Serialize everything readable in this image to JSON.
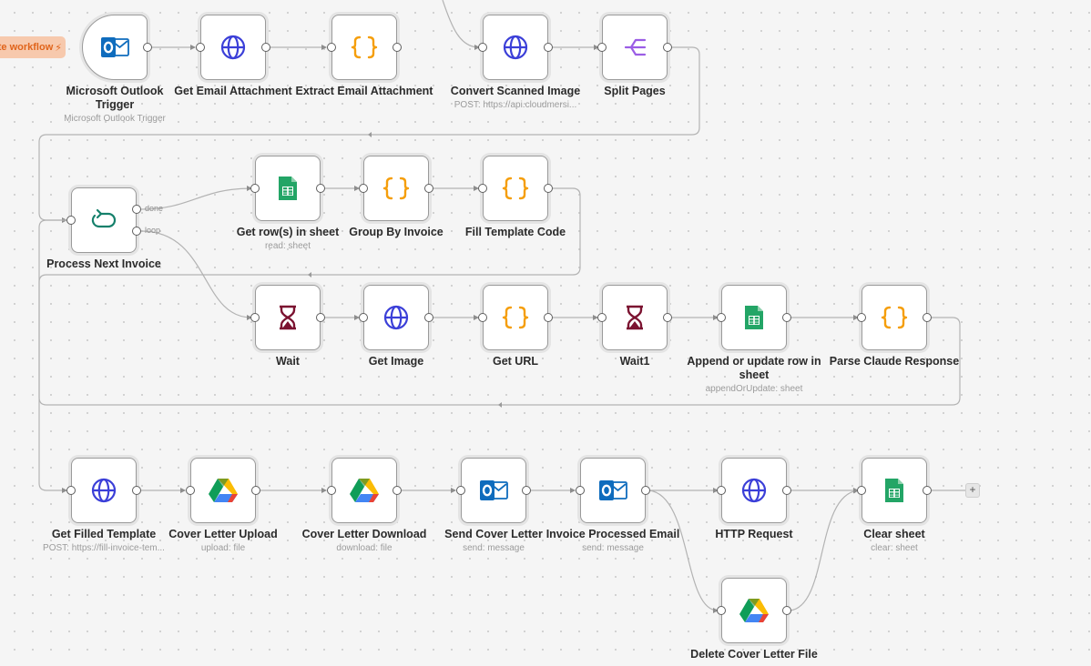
{
  "banner": {
    "text": "te workflow"
  },
  "nodes": [
    {
      "id": "outlook-trigger",
      "label": "Microsoft Outlook Trigger",
      "sub": "Microsoft Outlook Trigger",
      "icon": "outlook-icon",
      "trigger": true
    },
    {
      "id": "get-email-attachment",
      "label": "Get Email Attachment",
      "sub": "",
      "icon": "globe-icon"
    },
    {
      "id": "extract-email-attachment",
      "label": "Extract Email Attachment",
      "sub": "",
      "icon": "code-braces-icon"
    },
    {
      "id": "convert-scanned-image",
      "label": "Convert Scanned Image",
      "sub": "POST: https://api.cloudmersi...",
      "icon": "globe-icon"
    },
    {
      "id": "split-pages",
      "label": "Split Pages",
      "sub": "",
      "icon": "split-icon"
    },
    {
      "id": "process-next-invoice",
      "label": "Process Next Invoice",
      "sub": "",
      "icon": "loop-icon"
    },
    {
      "id": "get-rows-in-sheet",
      "label": "Get row(s) in sheet",
      "sub": "read: sheet",
      "icon": "sheets-icon"
    },
    {
      "id": "group-by-invoice",
      "label": "Group By Invoice",
      "sub": "",
      "icon": "code-braces-icon"
    },
    {
      "id": "fill-template-code",
      "label": "Fill Template Code",
      "sub": "",
      "icon": "code-braces-icon"
    },
    {
      "id": "wait",
      "label": "Wait",
      "sub": "",
      "icon": "hourglass-icon"
    },
    {
      "id": "get-image",
      "label": "Get Image",
      "sub": "",
      "icon": "globe-icon"
    },
    {
      "id": "get-url",
      "label": "Get URL",
      "sub": "",
      "icon": "code-braces-icon"
    },
    {
      "id": "wait1",
      "label": "Wait1",
      "sub": "",
      "icon": "hourglass-icon"
    },
    {
      "id": "append-or-update-row",
      "label": "Append or update row in sheet",
      "sub": "appendOrUpdate: sheet",
      "icon": "sheets-icon"
    },
    {
      "id": "parse-claude-response",
      "label": "Parse Claude Response",
      "sub": "",
      "icon": "code-braces-icon"
    },
    {
      "id": "get-filled-template",
      "label": "Get Filled Template",
      "sub": "POST: https://fill-invoice-tem...",
      "icon": "globe-icon"
    },
    {
      "id": "cover-letter-upload",
      "label": "Cover Letter Upload",
      "sub": "upload: file",
      "icon": "drive-icon"
    },
    {
      "id": "cover-letter-download",
      "label": "Cover Letter Download",
      "sub": "download: file",
      "icon": "drive-icon"
    },
    {
      "id": "send-cover-letter",
      "label": "Send Cover Letter",
      "sub": "send: message",
      "icon": "outlook-icon"
    },
    {
      "id": "invoice-processed-email",
      "label": "Invoice Processed Email",
      "sub": "send: message",
      "icon": "outlook-icon"
    },
    {
      "id": "http-request",
      "label": "HTTP Request",
      "sub": "",
      "icon": "globe-icon"
    },
    {
      "id": "clear-sheet",
      "label": "Clear sheet",
      "sub": "clear: sheet",
      "icon": "sheets-icon"
    },
    {
      "id": "delete-cover-letter-file",
      "label": "Delete Cover Letter File",
      "sub": "",
      "icon": "drive-icon"
    }
  ],
  "loop_outputs": {
    "done": "done",
    "loop": "loop"
  },
  "add_button": "+",
  "colors": {
    "globe": "#3b3fd8",
    "code": "#f59e0b",
    "split": "#9b5de5",
    "loop": "#15806b",
    "hourglass": "#7b1230",
    "sheets": "#23a566",
    "outlook": "#0f6cbd",
    "edge": "#b3b3b3",
    "port": "#5e5e5e"
  }
}
